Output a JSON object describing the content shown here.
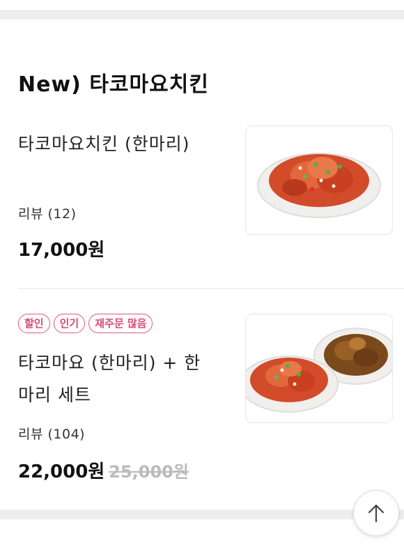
{
  "section": {
    "title": "New)  타코마요치킨"
  },
  "items": [
    {
      "name": "타코마요치킨 (한마리)",
      "review": "리뷰 (12)",
      "price": "17,000원",
      "badges": []
    },
    {
      "name": "타코마요 (한마리) + 한마리 세트",
      "review": "리뷰 (104)",
      "price": "22,000원",
      "original_price": "25,000원",
      "badges": [
        "할인",
        "인기",
        "재주문 많음"
      ]
    }
  ],
  "colors": {
    "badge": "#e0577e",
    "divider": "#eeeeee",
    "strike_price": "#bbbbbb"
  },
  "icons": {
    "scroll_top": "arrow-up-icon"
  }
}
